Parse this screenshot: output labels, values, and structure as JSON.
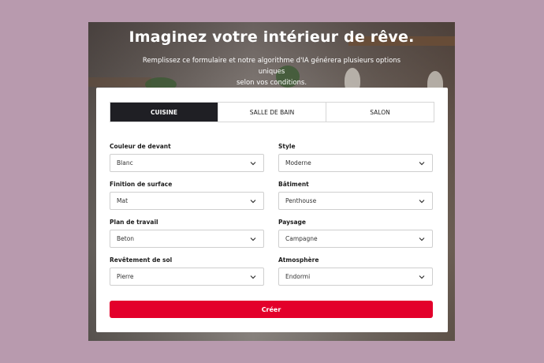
{
  "hero": {
    "title": "Imaginez votre intérieur de rêve.",
    "subtitle_line1": "Remplissez ce formulaire et notre algorithme d'IA générera plusieurs options uniques",
    "subtitle_line2": "selon vos conditions."
  },
  "tabs": [
    {
      "label": "CUISINE",
      "active": true
    },
    {
      "label": "SALLE DE BAIN",
      "active": false
    },
    {
      "label": "SALON",
      "active": false
    }
  ],
  "form": {
    "couleur": {
      "label": "Couleur de devant",
      "value": "Blanc"
    },
    "style": {
      "label": "Style",
      "value": "Moderne"
    },
    "finition": {
      "label": "Finition de surface",
      "value": "Mat"
    },
    "batiment": {
      "label": "Bâtiment",
      "value": "Penthouse"
    },
    "plan": {
      "label": "Plan de travail",
      "value": "Beton"
    },
    "paysage": {
      "label": "Paysage",
      "value": "Campagne"
    },
    "revetement": {
      "label": "Revêtement de sol",
      "value": "Pierre"
    },
    "atmosphere": {
      "label": "Atmosphère",
      "value": "Endormi"
    }
  },
  "submit_label": "Créer",
  "colors": {
    "accent": "#e3002b",
    "tab_active": "#1f1f24",
    "page_bg": "#b89aae"
  },
  "icons": [
    "chevron-down-icon"
  ]
}
